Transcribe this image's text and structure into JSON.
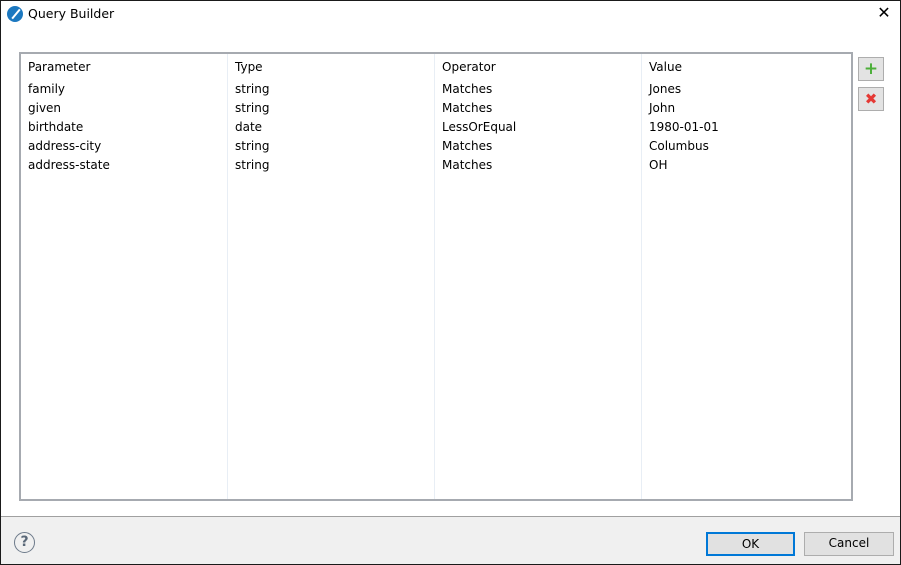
{
  "window": {
    "title": "Query Builder",
    "close_label": "✕"
  },
  "table": {
    "columns": [
      "Parameter",
      "Type",
      "Operator",
      "Value"
    ],
    "rows": [
      [
        "family",
        "string",
        "Matches",
        "Jones"
      ],
      [
        "given",
        "string",
        "Matches",
        "John"
      ],
      [
        "birthdate",
        "date",
        "LessOrEqual",
        "1980-01-01"
      ],
      [
        "address-city",
        "string",
        "Matches",
        "Columbus"
      ],
      [
        "address-state",
        "string",
        "Matches",
        "OH"
      ]
    ]
  },
  "side": {
    "add_glyph": "+",
    "remove_glyph": "✖"
  },
  "footer": {
    "help_glyph": "?",
    "ok_label": "OK",
    "cancel_label": "Cancel"
  },
  "colors": {
    "add": "#4caf3a",
    "remove": "#e53935",
    "focus": "#0078d7"
  }
}
